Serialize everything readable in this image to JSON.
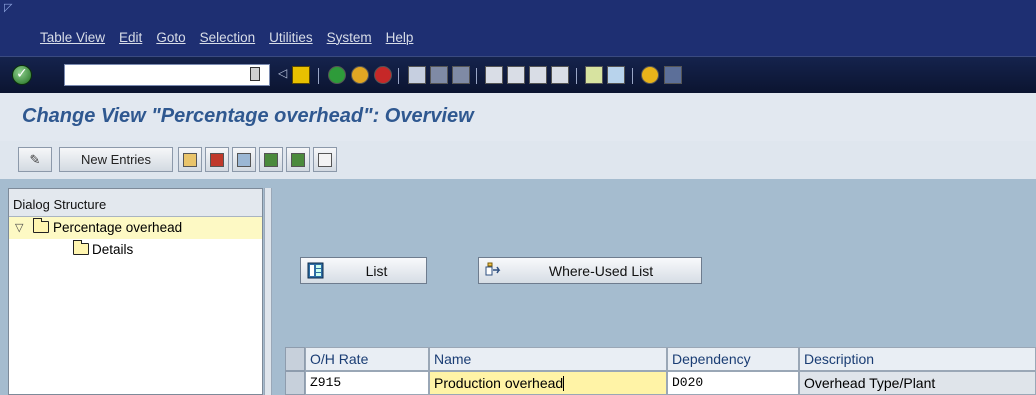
{
  "menu": {
    "items": [
      "Table View",
      "Edit",
      "Goto",
      "Selection",
      "Utilities",
      "System",
      "Help"
    ]
  },
  "system_toolbar": {
    "command_value": "",
    "icons": [
      "enter-icon",
      "back-icon",
      "exit-icon",
      "cancel-icon",
      "print-icon",
      "find-icon",
      "find-next-icon",
      "first-page-icon",
      "previous-page-icon",
      "next-page-icon",
      "last-page-icon",
      "create-session-icon",
      "shortcut-icon",
      "help-icon",
      "layout-icon"
    ]
  },
  "title": "Change View \"Percentage overhead\": Overview",
  "app_toolbar": {
    "new_entries_label": "New Entries"
  },
  "dialog_structure": {
    "header": "Dialog Structure",
    "items": [
      {
        "label": "Percentage overhead",
        "selected": true
      },
      {
        "label": "Details",
        "selected": false
      }
    ]
  },
  "buttons": {
    "list_label": "List",
    "where_used_label": "Where-Used List"
  },
  "table": {
    "columns": [
      "O/H Rate",
      "Name",
      "Dependency",
      "Description"
    ],
    "rows": [
      [
        "Z915",
        "Production overhead",
        "D020",
        "Overhead Type/Plant"
      ]
    ]
  },
  "colors": {
    "menubar": "#1e2f72",
    "title_text": "#2f5890",
    "background": "#a5bccf",
    "selected_row": "#fdf9c4",
    "active_cell": "#fff3a6"
  }
}
